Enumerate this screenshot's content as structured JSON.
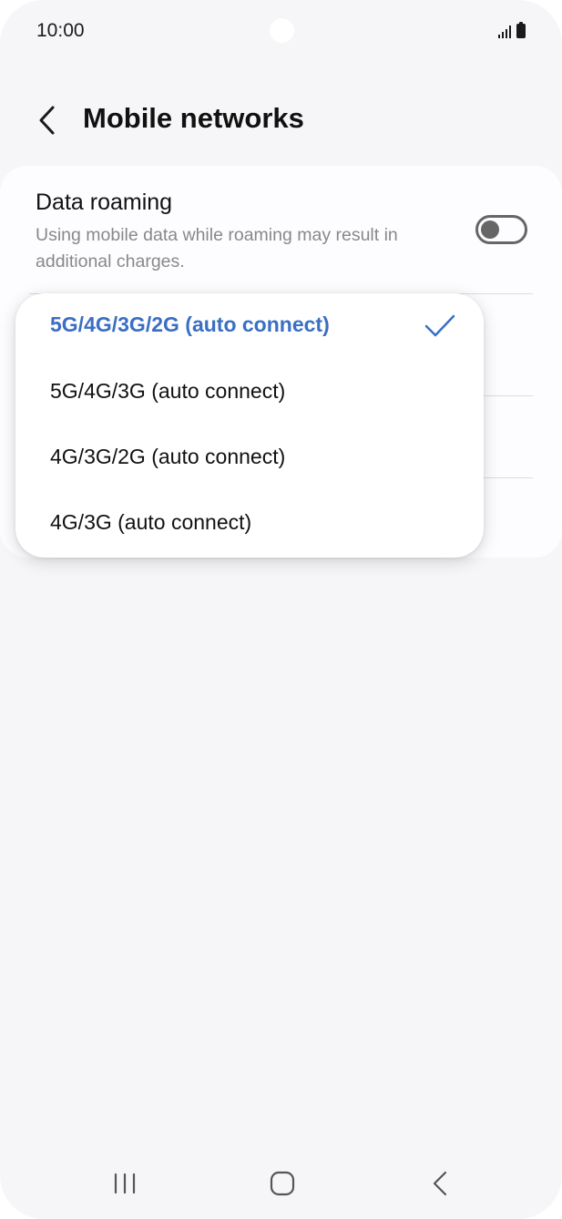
{
  "status_bar": {
    "time": "10:00",
    "icons": [
      "signal-icon",
      "battery-icon"
    ]
  },
  "header": {
    "title": "Mobile networks",
    "back_icon": "chevron-left-icon"
  },
  "settings": {
    "data_roaming": {
      "title": "Data roaming",
      "subtitle": "Using mobile data while roaming may result in additional charges.",
      "enabled": false
    }
  },
  "network_mode_menu": {
    "options": [
      {
        "label": "5G/4G/3G/2G (auto connect)",
        "selected": true
      },
      {
        "label": "5G/4G/3G (auto connect)",
        "selected": false
      },
      {
        "label": "4G/3G/2G (auto connect)",
        "selected": false
      },
      {
        "label": "4G/3G (auto connect)",
        "selected": false
      }
    ],
    "selected_icon": "check-icon"
  },
  "nav_bar": {
    "buttons": [
      "recents-icon",
      "home-icon",
      "back-icon"
    ]
  },
  "colors": {
    "accent": "#3a6fc4",
    "background": "#f6f6f8",
    "card": "#fdfdff",
    "secondary_text": "#888888"
  }
}
